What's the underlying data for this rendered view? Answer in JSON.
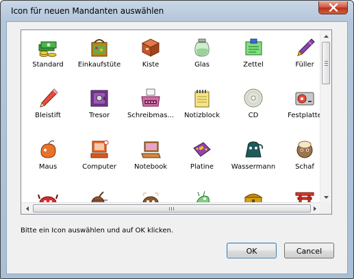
{
  "window": {
    "title": "Icon für neuen Mandanten auswählen"
  },
  "icons": [
    {
      "label": "Standard",
      "icon": "money-stack-icon"
    },
    {
      "label": "Einkaufstüte",
      "icon": "shopping-bag-icon"
    },
    {
      "label": "Kiste",
      "icon": "box-icon"
    },
    {
      "label": "Glas",
      "icon": "jar-icon"
    },
    {
      "label": "Zettel",
      "icon": "note-icon"
    },
    {
      "label": "Füller",
      "icon": "fountain-pen-icon"
    },
    {
      "label": "Bleistift",
      "icon": "pencil-icon"
    },
    {
      "label": "Tresor",
      "icon": "safe-icon"
    },
    {
      "label": "Schreibmas...",
      "icon": "typewriter-icon"
    },
    {
      "label": "Notizblock",
      "icon": "notepad-icon"
    },
    {
      "label": "CD",
      "icon": "cd-icon"
    },
    {
      "label": "Festplatte",
      "icon": "hard-disk-icon"
    },
    {
      "label": "Maus",
      "icon": "mouse-icon"
    },
    {
      "label": "Computer",
      "icon": "computer-icon"
    },
    {
      "label": "Notebook",
      "icon": "notebook-icon"
    },
    {
      "label": "Platine",
      "icon": "circuit-board-icon"
    },
    {
      "label": "Wassermann",
      "icon": "aquarius-icon"
    },
    {
      "label": "Schaf",
      "icon": "sheep-icon"
    },
    {
      "label": "",
      "icon": "crab-icon"
    },
    {
      "label": "",
      "icon": "archer-icon"
    },
    {
      "label": "",
      "icon": "bull-icon"
    },
    {
      "label": "",
      "icon": "dragon-icon"
    },
    {
      "label": "",
      "icon": "treasure-chest-icon"
    },
    {
      "label": "",
      "icon": "torii-gate-icon"
    }
  ],
  "hint": "Bitte ein Icon auswählen und auf OK klicken.",
  "buttons": {
    "ok": "OK",
    "cancel": "Cancel"
  },
  "scroll": {
    "vertical_position": 0.0,
    "horizontal_position": 0.0
  }
}
